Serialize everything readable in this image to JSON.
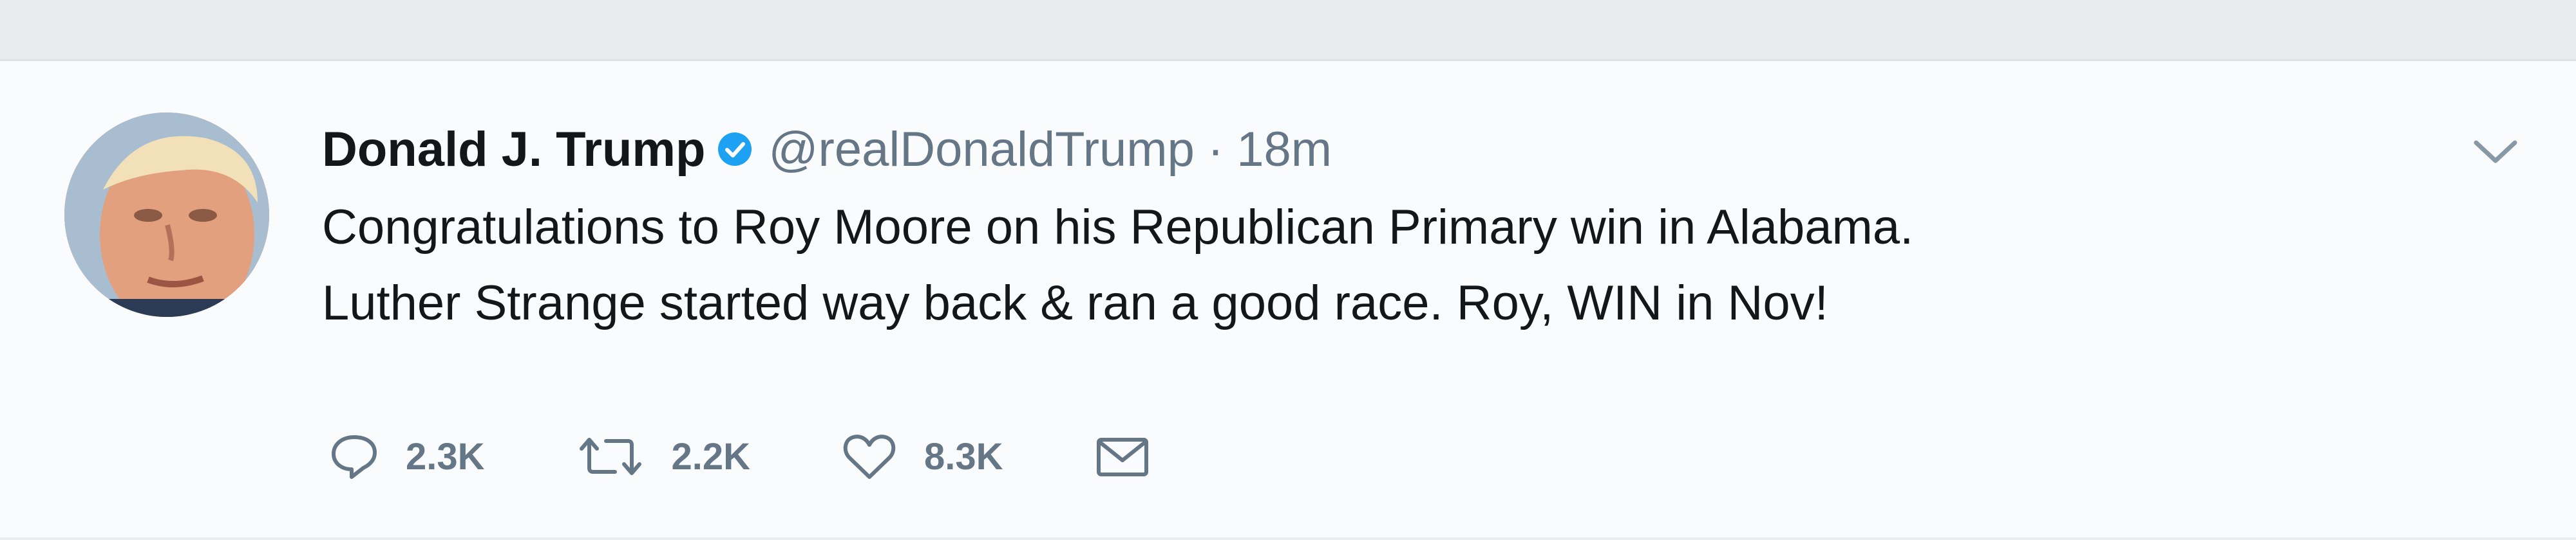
{
  "tweet": {
    "display_name": "Donald J. Trump",
    "handle": "@realDonaldTrump",
    "separator": "·",
    "time": "18m",
    "text_lines": [
      "Congratulations to Roy Moore on his Republican Primary win in Alabama.",
      "Luther Strange started way back & ran a good race. Roy, WIN in Nov!"
    ],
    "verified_icon": "verified-badge-icon",
    "more_icon": "chevron-down-icon"
  },
  "actions": {
    "reply": {
      "icon": "reply-icon",
      "count": "2.3K"
    },
    "retweet": {
      "icon": "retweet-icon",
      "count": "2.2K"
    },
    "like": {
      "icon": "heart-icon",
      "count": "8.3K"
    },
    "message": {
      "icon": "envelope-icon"
    }
  },
  "colors": {
    "text": "#14171a",
    "secondary": "#657786",
    "verified": "#1da1f2",
    "background": "#fafbfc"
  }
}
